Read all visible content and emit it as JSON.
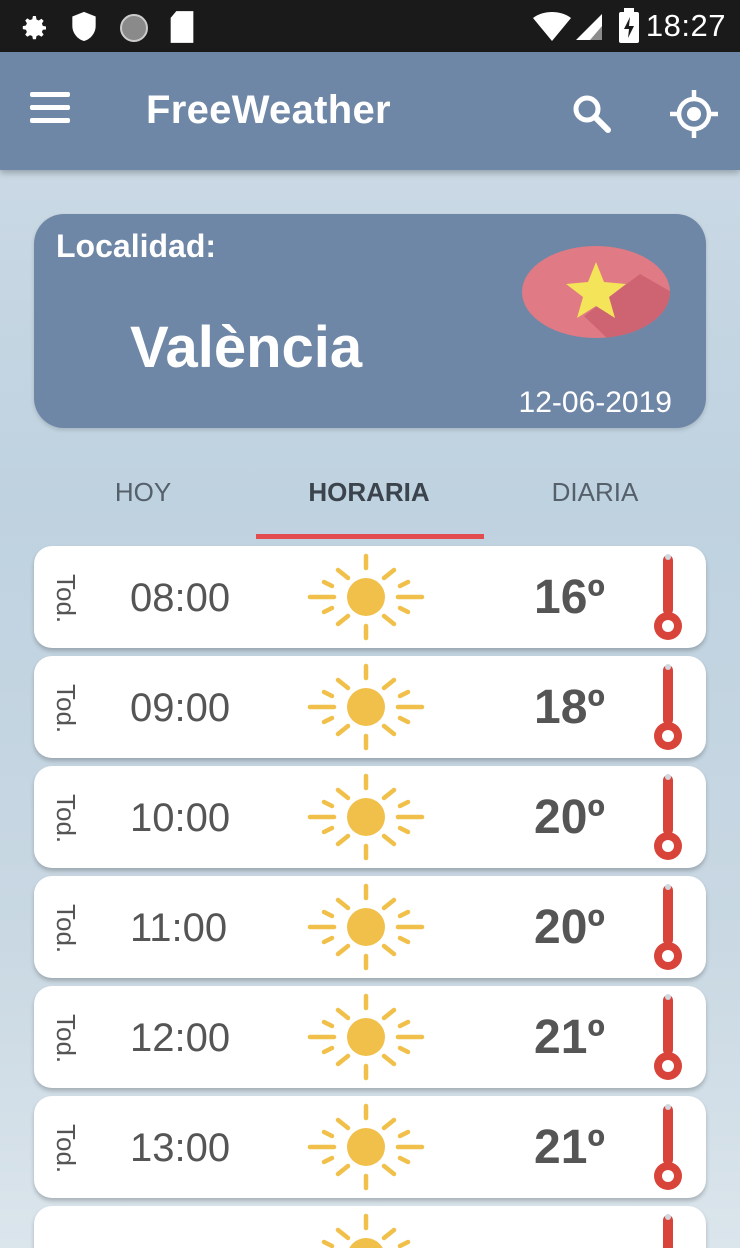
{
  "status_bar": {
    "time": "18:27",
    "left_icons": [
      "gear-icon",
      "shield-icon",
      "circle-icon",
      "sd-card-icon"
    ],
    "right_icons": [
      "wifi-icon",
      "signal-icon",
      "battery-icon"
    ]
  },
  "app_bar": {
    "title": "FreeWeather",
    "menu_icon": "hamburger-icon",
    "search_icon": "search-icon",
    "location_icon": "crosshair-icon"
  },
  "location": {
    "label": "Localidad:",
    "city": "València",
    "date": "12-06-2019",
    "favorite_icon": "star-icon"
  },
  "tabs": [
    {
      "label": "HOY",
      "active": false
    },
    {
      "label": "HORARIA",
      "active": true
    },
    {
      "label": "DIARIA",
      "active": false
    }
  ],
  "hourly": [
    {
      "day": "Tod.",
      "time": "08:00",
      "condition_icon": "sun-icon",
      "temp": "16º"
    },
    {
      "day": "Tod.",
      "time": "09:00",
      "condition_icon": "sun-icon",
      "temp": "18º"
    },
    {
      "day": "Tod.",
      "time": "10:00",
      "condition_icon": "sun-icon",
      "temp": "20º"
    },
    {
      "day": "Tod.",
      "time": "11:00",
      "condition_icon": "sun-icon",
      "temp": "20º"
    },
    {
      "day": "Tod.",
      "time": "12:00",
      "condition_icon": "sun-icon",
      "temp": "21º"
    },
    {
      "day": "Tod.",
      "time": "13:00",
      "condition_icon": "sun-icon",
      "temp": "21º"
    }
  ],
  "colors": {
    "app_bar": "#6f87a6",
    "tab_indicator": "#e24c4c",
    "sun": "#f0c04a",
    "thermometer": "#d9443a",
    "favorite_bg": "#e07a84",
    "favorite_star": "#f3e45a"
  }
}
